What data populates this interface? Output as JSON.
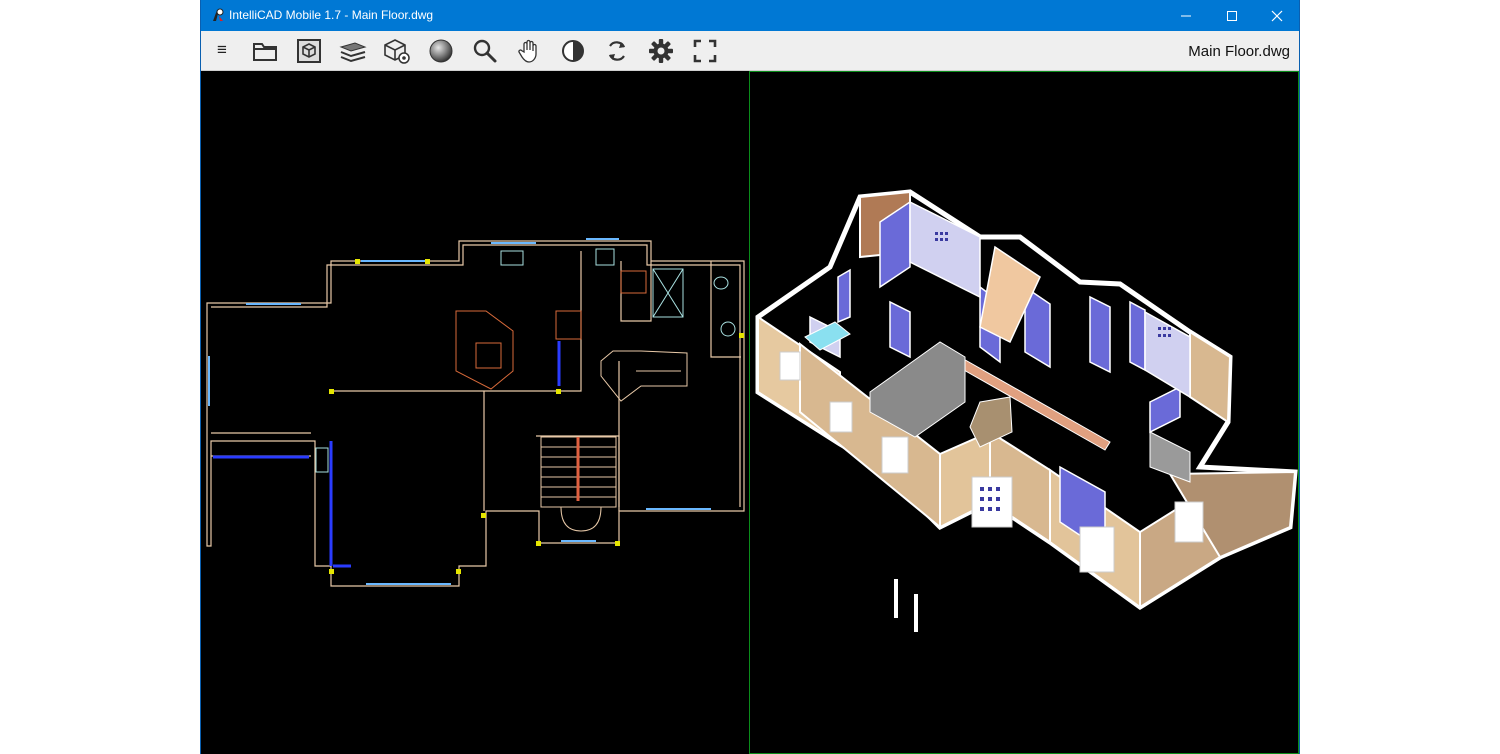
{
  "window": {
    "title": "IntelliCAD Mobile 1.7 - Main Floor.dwg",
    "app_icon": "intellicad-logo-icon",
    "controls": [
      "minimize-icon",
      "maximize-icon",
      "close-icon"
    ]
  },
  "toolbar": {
    "menu_glyph": "≡",
    "buttons": [
      "folder-icon",
      "view-cube-icon",
      "layers-icon",
      "3d-settings-icon",
      "render-sphere-icon",
      "zoom-icon",
      "pan-hand-icon",
      "contrast-icon",
      "regenerate-icon",
      "settings-icon",
      "fullscreen-icon"
    ],
    "file_name": "Main Floor.dwg"
  },
  "colors": {
    "titlebar": "#0078d4",
    "toolbar": "#efefef",
    "canvas": "#000000",
    "active_viewport_border": "#0a8c1a"
  },
  "viewports": {
    "left": "2d-floor-plan",
    "right": "3d-isometric-model"
  }
}
